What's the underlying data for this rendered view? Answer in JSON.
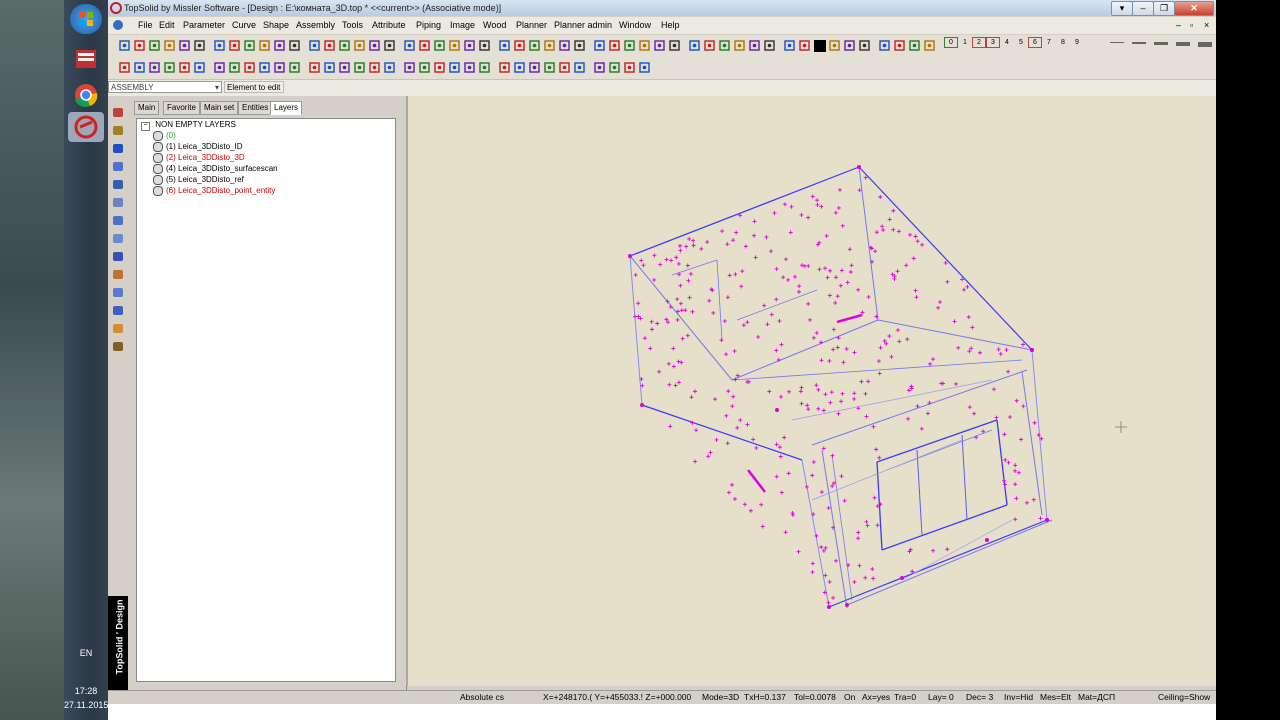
{
  "title": "TopSolid by Missler Software - [Design : E:\\комната_3D.top *  <<current>> (Associative mode)]",
  "menus": [
    "File",
    "Edit",
    "Parameter",
    "Curve",
    "Shape",
    "Assembly",
    "Tools",
    "Attribute",
    "Piping",
    "Image",
    "Wood",
    "Planner",
    "Planner admin",
    "Window",
    "Help"
  ],
  "context": {
    "mode": "ASSEMBLY",
    "element_placeholder": "Element to edit"
  },
  "tabs": [
    "Main",
    "Favorite",
    "Main set",
    "Entities",
    "Layers"
  ],
  "tree": {
    "root": "NON EMPTY LAYERS",
    "layers": [
      {
        "label": "(0)",
        "color": "#22aa22"
      },
      {
        "label": "(1) Leica_3DDisto_ID",
        "color": "#000000"
      },
      {
        "label": "(2) Leica_3DDisto_3D",
        "color": "#cc0000"
      },
      {
        "label": "(4) Leica_3DDisto_surfacescan",
        "color": "#000000"
      },
      {
        "label": "(5) Leica_3DDisto_ref",
        "color": "#000000"
      },
      {
        "label": "(6) Leica_3DDisto_point_entity",
        "color": "#cc0000"
      }
    ]
  },
  "brand": "TopSolid ' Design",
  "status": {
    "cs": "Absolute cs",
    "coords": "X=+248170.( Y=+455033.! Z=+000.000",
    "mode": "Mode=3D",
    "txh": "TxH=0.137",
    "tol": "Tol=0.0078",
    "on": "On",
    "axes": "Ax=yes",
    "tra": "Tra=0",
    "lay": "Lay=  0",
    "dec": "Dec= 3",
    "inv": "Inv=Hid",
    "mes": "Mes=Elt",
    "mat": "Mat=ДСП",
    "ceiling": "Ceiling=Show"
  },
  "taskbar": {
    "lang": "EN",
    "time": "17:28",
    "date": "27.11.2015"
  },
  "line_width_labels": [
    "0",
    "1",
    "2",
    "3",
    "4",
    "5",
    "6",
    "7",
    "8",
    "9"
  ],
  "colors": {
    "wire_blue": "#3a3aff",
    "point_magenta": "#e000e0",
    "viewport_bg": "#e6dfc9"
  }
}
